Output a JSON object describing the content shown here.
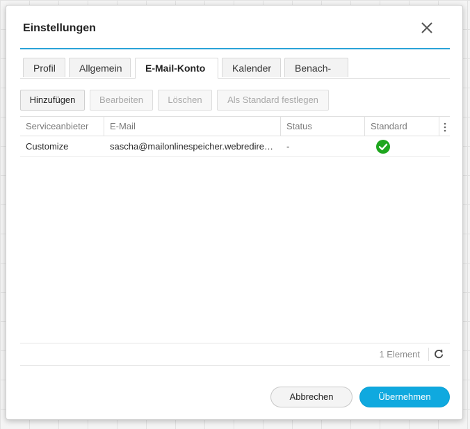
{
  "dialog": {
    "title": "Einstellungen",
    "close_icon": "close-icon"
  },
  "tabs": [
    {
      "label": "Profil",
      "active": false
    },
    {
      "label": "Allgemein",
      "active": false
    },
    {
      "label": "E-Mail-Konto",
      "active": true
    },
    {
      "label": "Kalender",
      "active": false
    },
    {
      "label": "Benach-",
      "active": false
    }
  ],
  "toolbar": {
    "add_label": "Hinzufügen",
    "edit_label": "Bearbeiten",
    "delete_label": "Löschen",
    "set_default_label": "Als Standard festlegen"
  },
  "grid": {
    "columns": [
      "Serviceanbieter",
      "E-Mail",
      "Status",
      "Standard"
    ],
    "menu_icon": "column-menu-icon",
    "rows": [
      {
        "provider": "Customize",
        "email": "sascha@mailonlinespeicher.webredire…",
        "status": "-",
        "default_icon": "check-circle-icon"
      }
    ],
    "count_text": "1 Element",
    "refresh_icon": "refresh-icon"
  },
  "footer": {
    "cancel_label": "Abbrechen",
    "apply_label": "Übernehmen"
  },
  "colors": {
    "accent": "#0fa9df",
    "title_rule": "#2aa3d8",
    "check_green": "#1ea61e"
  }
}
